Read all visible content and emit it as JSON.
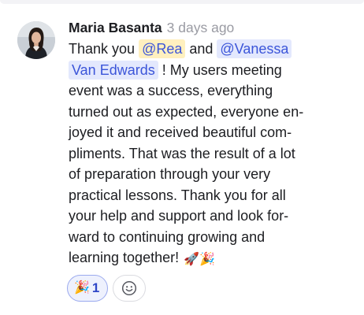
{
  "comment": {
    "author": "Maria Basanta",
    "timestamp": "3 days ago",
    "mentions": [
      "@Rea",
      "@Vanessa",
      "Van Edwards"
    ],
    "lines": [
      {
        "before": "Thank you ",
        "mention1": "@Rea",
        "middle": " and ",
        "mention2": "@Vanessa"
      },
      {
        "mention": "Van Edwards",
        "after": " ! My users meeting"
      },
      "event was a success, everything",
      "turned out as expected, everyone en-",
      "joyed it and received beautiful com-",
      "pliments. That was the result of a lot",
      "of preparation through your very",
      "practical lessons. Thank you for all",
      "your help and support and look for-",
      "ward to continuing growing and",
      {
        "text": "learning together!",
        "emoji": "🚀🎉"
      }
    ]
  },
  "reactions": [
    {
      "emoji": "🎉",
      "count": "1",
      "icon": "party-popper-icon"
    }
  ],
  "add_reaction": {
    "icon": "smiley-face-icon"
  },
  "colors": {
    "mention_text": "#3b55d9",
    "mention_bg_yellow": "#fff0bf",
    "mention_bg_blue": "#e3e8fd",
    "timestamp": "#9a9ba3",
    "reaction_border": "#9aa9ee",
    "reaction_bg": "#eef1fd"
  }
}
